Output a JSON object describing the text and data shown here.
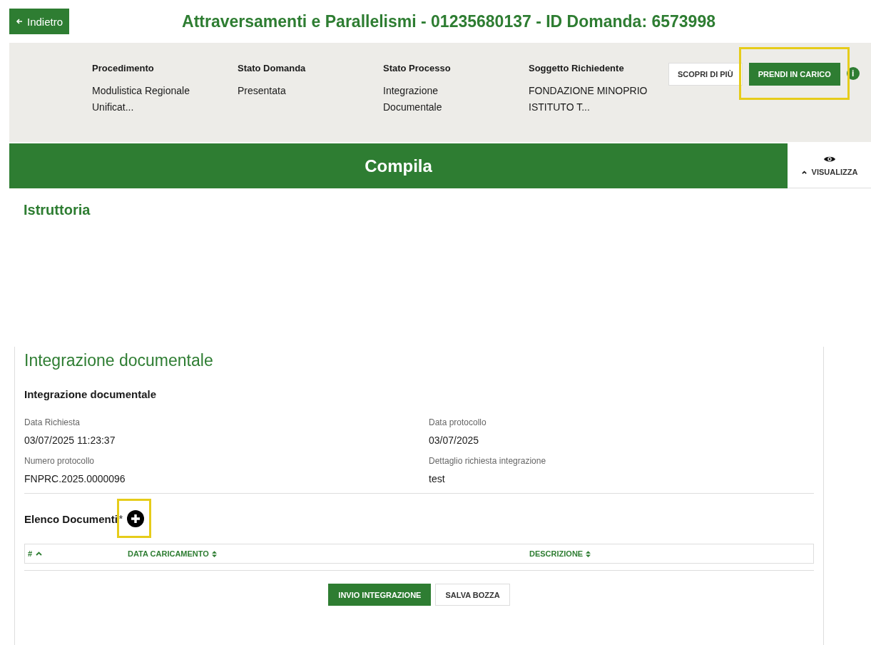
{
  "back_button": {
    "label": "Indietro"
  },
  "title": "Attraversamenti e Parallelismi - 01235680137 - ID Domanda: 6573998",
  "summary": [
    {
      "label": "Procedimento",
      "value": "Modulistica Regionale Unificat..."
    },
    {
      "label": "Stato Domanda",
      "value": "Presentata"
    },
    {
      "label": "Stato Processo",
      "value": "Integrazione Documentale"
    },
    {
      "label": "Soggetto Richiedente",
      "value": "FONDAZIONE MINOPRIO ISTITUTO T..."
    }
  ],
  "actions": [
    {
      "label": "SCOPRI DI PIÙ",
      "kind": "secondary",
      "highlighted": false
    },
    {
      "label": "PRENDI IN CARICO",
      "kind": "primary",
      "highlighted": true
    }
  ],
  "info_icon": "i",
  "compile_bar": {
    "label": "Compila"
  },
  "view_toggle": {
    "label": "VISUALIZZA",
    "expanded": true
  },
  "section_title": "Istruttoria",
  "card": {
    "title": "Integrazione documentale",
    "subtitle": "Integrazione documentale",
    "fields": [
      {
        "label": "Data Richiesta",
        "value": "03/07/2025 11:23:37"
      },
      {
        "label": "Data protocollo",
        "value": "03/07/2025"
      },
      {
        "label": "Numero protocollo",
        "value": "FNPRC.2025.0000096"
      },
      {
        "label": "Dettaglio richiesta integrazione",
        "value": "test"
      }
    ],
    "documents": {
      "label": "Elenco Documenti",
      "required_mark": "*",
      "add_highlighted": true,
      "columns": [
        {
          "label": "#",
          "sorted": true
        },
        {
          "label": "DATA CARICAMENTO",
          "sorted": false
        },
        {
          "label": "DESCRIZIONE",
          "sorted": false
        }
      ]
    },
    "buttons": [
      {
        "label": "INVIO INTEGRAZIONE",
        "kind": "primary"
      },
      {
        "label": "SALVA BOZZA",
        "kind": "secondary"
      }
    ]
  }
}
